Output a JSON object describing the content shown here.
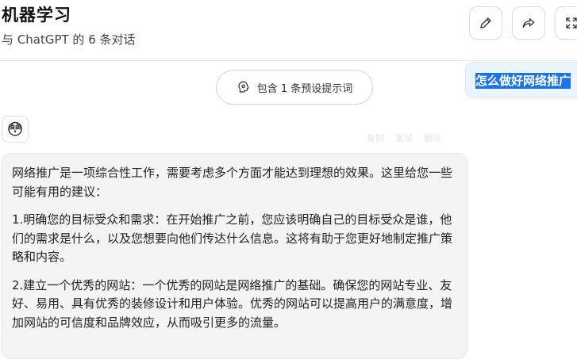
{
  "header": {
    "title": "机器学习",
    "subtitle": "与 ChatGPT 的 6 条对话"
  },
  "toolbar": {
    "edit_icon": "pencil-icon",
    "share_icon": "share-icon",
    "expand_icon": "expand-icon"
  },
  "prompt_pill": {
    "label": "包含 1 条预设提示词",
    "icon": "brain-icon"
  },
  "user_message": {
    "text": "怎么做好网络推广"
  },
  "assistant": {
    "avatar": "😳",
    "faint_actions": [
      "复制",
      "重试",
      "删除"
    ],
    "paragraphs": [
      "网络推广是一项综合性工作，需要考虑多个方面才能达到理想的效果。这里给您一些可能有用的建议：",
      "1.明确您的目标受众和需求：在开始推广之前，您应该明确自己的目标受众是谁，他们的需求是什么，以及您想要向他们传达什么信息。这将有助于您更好地制定推广策略和内容。",
      "2.建立一个优秀的网站：一个优秀的网站是网络推广的基础。确保您的网站专业、友好、易用、具有优秀的装修设计和用户体验。优秀的网站可以提高用户的满意度，增加网站的可信度和品牌效应，从而吸引更多的流量。"
    ]
  },
  "colors": {
    "user_bubble": "#eaf4fd",
    "selection": "#1a73e8",
    "assistant_bubble": "#f4f4f4"
  }
}
